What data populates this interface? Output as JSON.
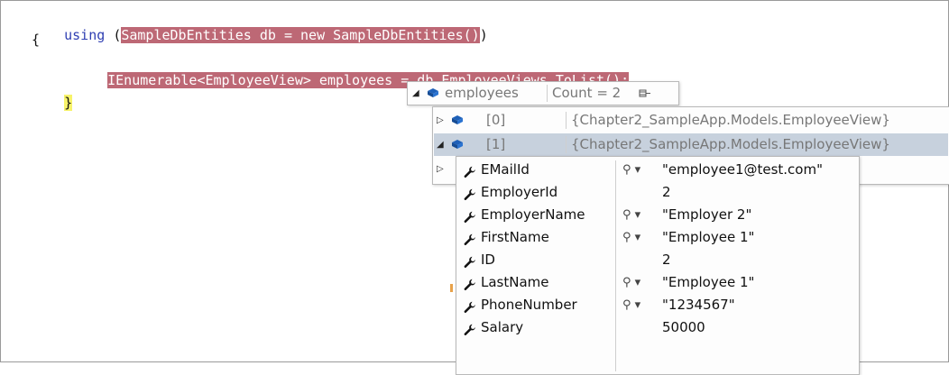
{
  "code": {
    "line1": {
      "keyword": "using",
      "open": "(",
      "highlight": "SampleDbEntities db = new SampleDbEntities()",
      "close": ")"
    },
    "line2": "{",
    "line3": "IEnumerable<EmployeeView> employees = db.EmployeeViews.ToList();",
    "line4": "}"
  },
  "tooltip": {
    "name": "employees",
    "value": "Count = 2"
  },
  "items": [
    {
      "index": "[0]",
      "value": "{Chapter2_SampleApp.Models.EmployeeView}"
    },
    {
      "index": "[1]",
      "value": "{Chapter2_SampleApp.Models.EmployeeView}"
    }
  ],
  "properties": [
    {
      "name": "EMailId",
      "value": "\"employee1@test.com\"",
      "has_viewer": true
    },
    {
      "name": "EmployerId",
      "value": "2",
      "has_viewer": false
    },
    {
      "name": "EmployerName",
      "value": "\"Employer 2\"",
      "has_viewer": true
    },
    {
      "name": "FirstName",
      "value": "\"Employee 1\"",
      "has_viewer": true
    },
    {
      "name": "ID",
      "value": "2",
      "has_viewer": false
    },
    {
      "name": "LastName",
      "value": "\"Employee 1\"",
      "has_viewer": true
    },
    {
      "name": "PhoneNumber",
      "value": "\"1234567\"",
      "has_viewer": true
    },
    {
      "name": "Salary",
      "value": "50000",
      "has_viewer": false
    }
  ],
  "icons": {
    "expand": "triangle-right-icon",
    "collapse": "triangle-down-icon",
    "object": "object-icon",
    "property": "wrench-icon",
    "viewer": "magnifier-icon",
    "pin": "pin-icon"
  },
  "colors": {
    "highlight": "#bd6875",
    "keyword": "#2f3fb2",
    "brace": "#f7f36a",
    "selected_row": "#c7d1dd"
  }
}
